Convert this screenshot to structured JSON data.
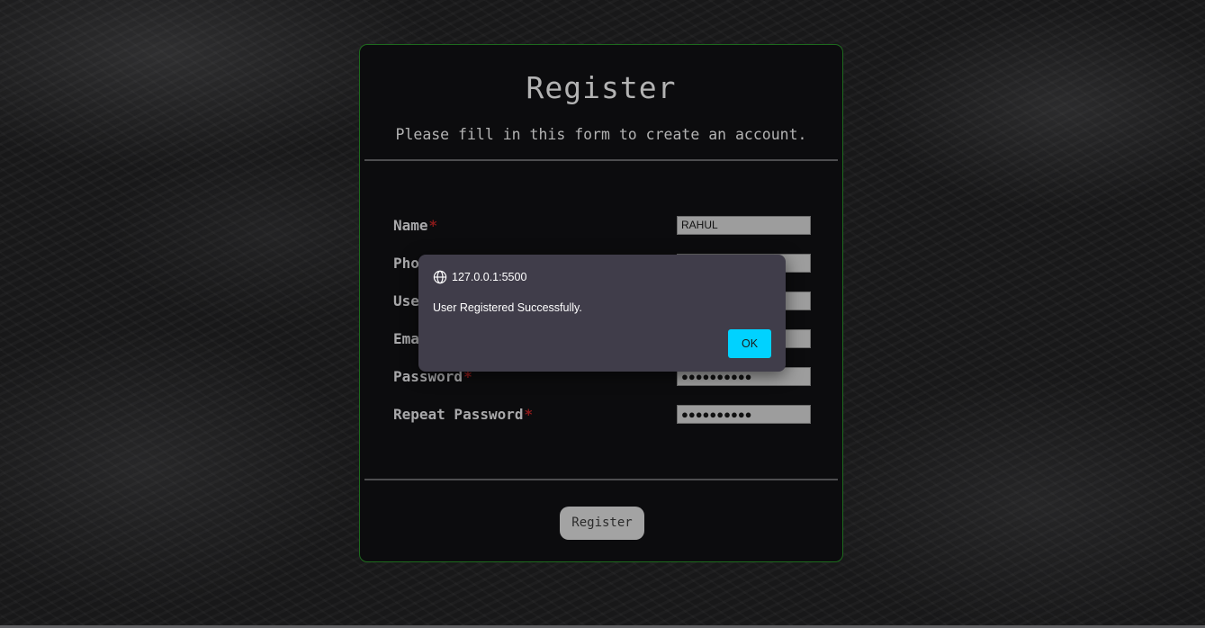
{
  "form": {
    "title": "Register",
    "subtitle": "Please fill in this form to create an account.",
    "required_marker": "*",
    "fields": [
      {
        "label": "Name",
        "value": "RAHUL"
      },
      {
        "label": "Phone",
        "value": ""
      },
      {
        "label": "Username",
        "value": ""
      },
      {
        "label": "Email",
        "value": ""
      },
      {
        "label": "Password",
        "value": "●●●●●●●●●●"
      },
      {
        "label": "Repeat Password",
        "value": "●●●●●●●●●●"
      }
    ],
    "submit_label": "Register"
  },
  "dialog": {
    "origin": "127.0.0.1:5500",
    "message": "User Registered Successfully.",
    "ok_label": "OK",
    "icon": "globe-icon"
  },
  "colors": {
    "card_border": "#1e6a1e",
    "required_marker": "#8b1a1a",
    "ok_button": "#00d2ff",
    "dialog_background": "#403d4a"
  }
}
